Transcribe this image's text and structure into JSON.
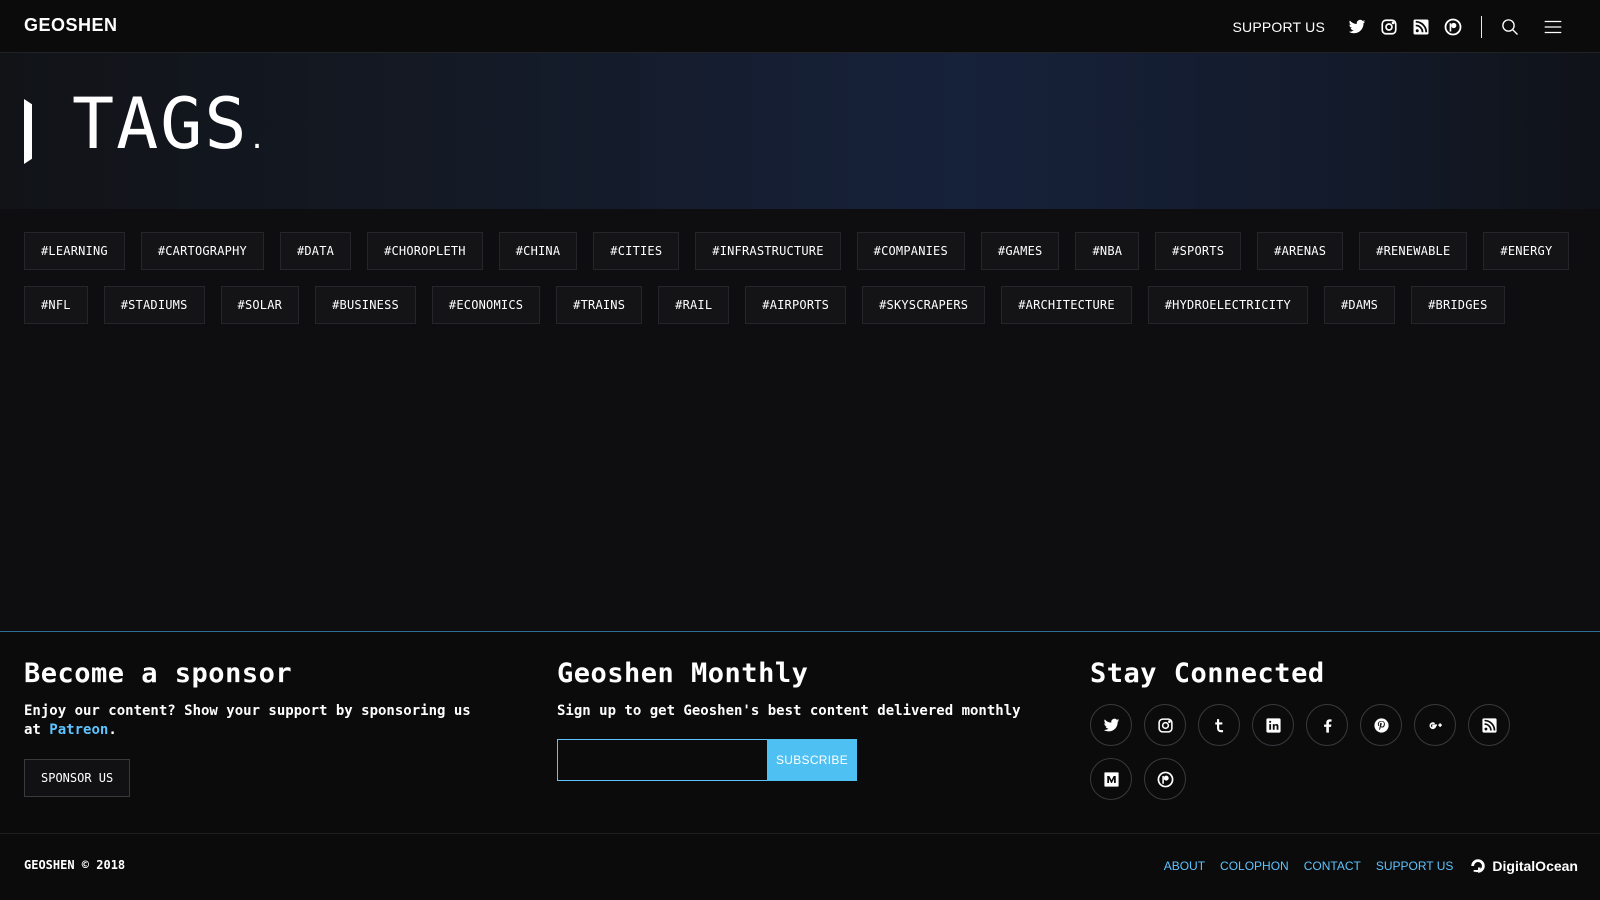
{
  "header": {
    "brand": "GEOSHEN",
    "support_label": "SUPPORT US",
    "icons": [
      "twitter-icon",
      "instagram-icon",
      "rss-icon",
      "patreon-icon",
      "search-icon",
      "hamburger-menu-icon"
    ]
  },
  "hero": {
    "title": "TAGS",
    "dot": "."
  },
  "tags": [
    "#LEARNING",
    "#CARTOGRAPHY",
    "#DATA",
    "#CHOROPLETH",
    "#CHINA",
    "#CITIES",
    "#INFRASTRUCTURE",
    "#COMPANIES",
    "#GAMES",
    "#NBA",
    "#SPORTS",
    "#ARENAS",
    "#RENEWABLE",
    "#ENERGY",
    "#NFL",
    "#STADIUMS",
    "#SOLAR",
    "#BUSINESS",
    "#ECONOMICS",
    "#TRAINS",
    "#RAIL",
    "#AIRPORTS",
    "#SKYSCRAPERS",
    "#ARCHITECTURE",
    "#HYDROELECTRICITY",
    "#DAMS",
    "#BRIDGES"
  ],
  "footer": {
    "sponsor": {
      "heading": "Become a sponsor",
      "text_before": "Enjoy our content? Show your support by sponsoring us at ",
      "link": "Patreon",
      "text_after": ".",
      "button": "SPONSOR US"
    },
    "newsletter": {
      "heading": "Geoshen Monthly",
      "text": "Sign up to get Geoshen's best content delivered monthly",
      "email_value": "",
      "button": "SUBSCRIBE"
    },
    "social": {
      "heading": "Stay Connected",
      "icons": [
        "twitter-icon",
        "instagram-icon",
        "tumblr-icon",
        "linkedin-icon",
        "facebook-icon",
        "pinterest-icon",
        "google-plus-icon",
        "rss-icon",
        "medium-icon",
        "patreon-icon"
      ]
    },
    "copyright": "GEOSHEN © 2018",
    "links": [
      "ABOUT",
      "COLOPHON",
      "CONTACT",
      "SUPPORT US"
    ],
    "host_logo": "DigitalOcean"
  },
  "colors": {
    "accent": "#5fc3ff",
    "subscribe_button": "#4fc0f2",
    "background": "#0e0e10"
  }
}
